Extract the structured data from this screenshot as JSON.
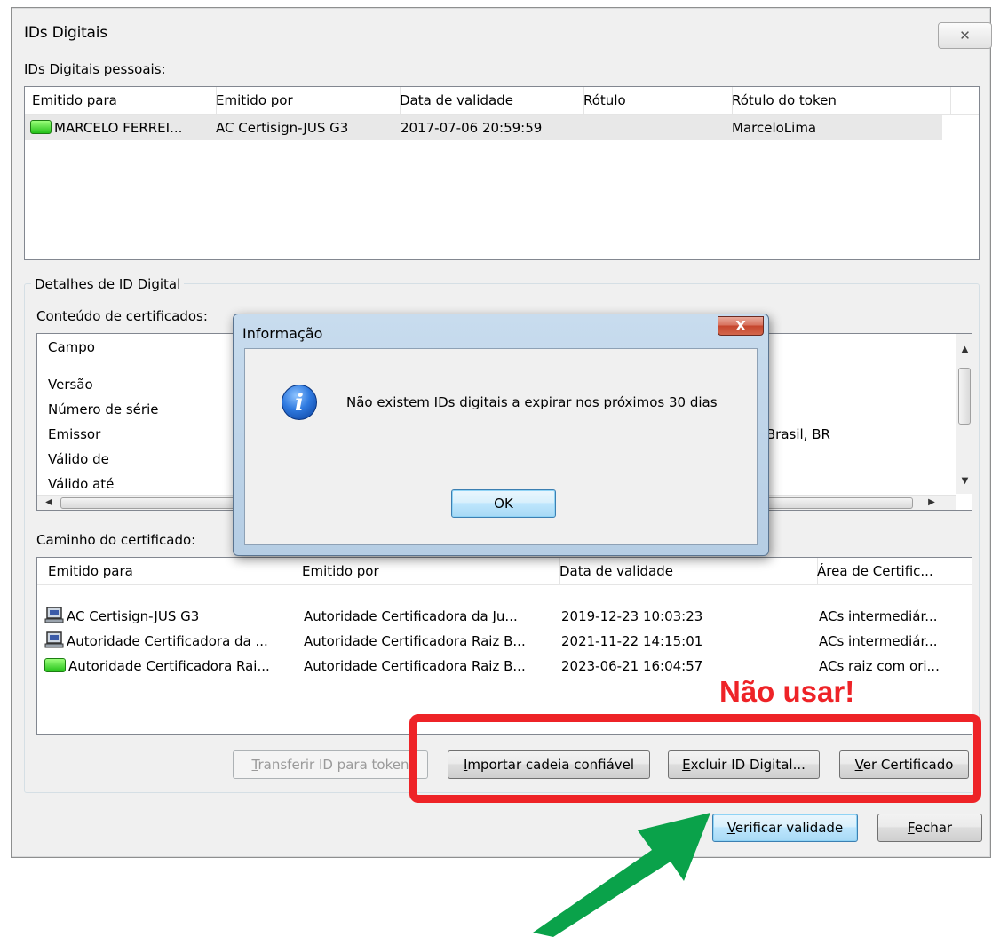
{
  "window": {
    "title": "IDs Digitais",
    "close_glyph": "✕"
  },
  "personal_ids": {
    "label": "IDs Digitais pessoais:",
    "columns": [
      "Emitido para",
      "Emitido por",
      "Data de validade",
      "Rótulo",
      "Rótulo do token"
    ],
    "rows": [
      {
        "issued_to": "MARCELO FERREI...",
        "issued_by": "AC Certisign-JUS G3",
        "valid_until": "2017-07-06 20:59:59",
        "label": "",
        "token_label": "MarceloLima"
      }
    ]
  },
  "details": {
    "group_label": "Detalhes de ID Digital",
    "content_label": "Conteúdo de certificados:",
    "field_header": "Campo",
    "fields": [
      "Versão",
      "Número de série",
      "Emissor",
      "Válido de",
      "Válido até"
    ],
    "emissor_value_fragment": "-Brasil, BR"
  },
  "path": {
    "label": "Caminho do certificado:",
    "columns": [
      "Emitido para",
      "Emitido por",
      "Data de validade",
      "Área de Certific..."
    ],
    "rows": [
      {
        "issued_to": "AC Certisign-JUS G3",
        "issued_by": "Autoridade Certificadora da Ju...",
        "valid_until": "2019-12-23 10:03:23",
        "area": "ACs intermediár...",
        "icon": "computer-icon"
      },
      {
        "issued_to": "Autoridade Certificadora da ...",
        "issued_by": "Autoridade Certificadora Raiz B...",
        "valid_until": "2021-11-22 14:15:01",
        "area": "ACs intermediár...",
        "icon": "computer-icon"
      },
      {
        "issued_to": "Autoridade Certificadora Rai...",
        "issued_by": "Autoridade Certificadora Raiz B...",
        "valid_until": "2023-06-21 16:04:57",
        "area": "ACs raiz com ori...",
        "icon": "green-chip-icon"
      }
    ]
  },
  "buttons": {
    "transfer": {
      "accel": "T",
      "rest": "ransferir ID para token"
    },
    "import": {
      "accel": "I",
      "rest": "mportar cadeia confiável"
    },
    "delete": {
      "accel": "E",
      "rest": "xcluir ID Digital..."
    },
    "view": {
      "accel": "V",
      "rest": "er Certificado"
    },
    "verify": {
      "accel": "V",
      "rest": "erificar validade"
    },
    "close": {
      "accel": "F",
      "rest": "echar"
    }
  },
  "dialog": {
    "title": "Informação",
    "message": "Não existem IDs digitais a expirar nos próximos 30 dias",
    "ok_label": "OK",
    "close_glyph": "X",
    "icon_glyph": "i"
  },
  "annotation": {
    "warning_text": "Não usar!",
    "warning_color": "#ee2327",
    "arrow_color": "#0aa24a"
  }
}
